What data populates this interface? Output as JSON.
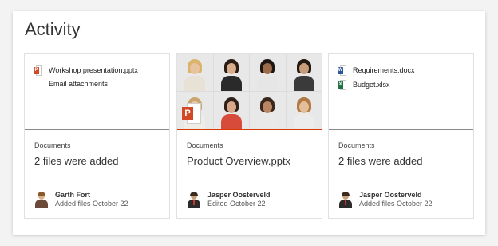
{
  "header": {
    "title": "Activity"
  },
  "cards": [
    {
      "files": [
        {
          "name": "Workshop presentation.pptx",
          "icon": "pptx-file-icon",
          "badge": "P"
        }
      ],
      "subtext": "Email attachments",
      "category": "Documents",
      "headline": "2 files were added",
      "person": {
        "name": "Garth Fort",
        "meta": "Added files October 22"
      }
    },
    {
      "category": "Documents",
      "headline": "Product Overview.pptx",
      "thumb_badge": "P",
      "person": {
        "name": "Jasper Oosterveld",
        "meta": "Edited October 22"
      }
    },
    {
      "files": [
        {
          "name": "Requirements.docx",
          "icon": "docx-file-icon",
          "badge": "W"
        },
        {
          "name": "Budget.xlsx",
          "icon": "xlsx-file-icon",
          "badge": "X"
        }
      ],
      "category": "Documents",
      "headline": "2 files were added",
      "person": {
        "name": "Jasper Oosterveld",
        "meta": "Added files October 22"
      }
    }
  ],
  "colors": {
    "accent": "#d83b01",
    "divider": "#8a8a8a",
    "pptx": "#d24726",
    "docx": "#2b579a",
    "xlsx": "#217346"
  }
}
